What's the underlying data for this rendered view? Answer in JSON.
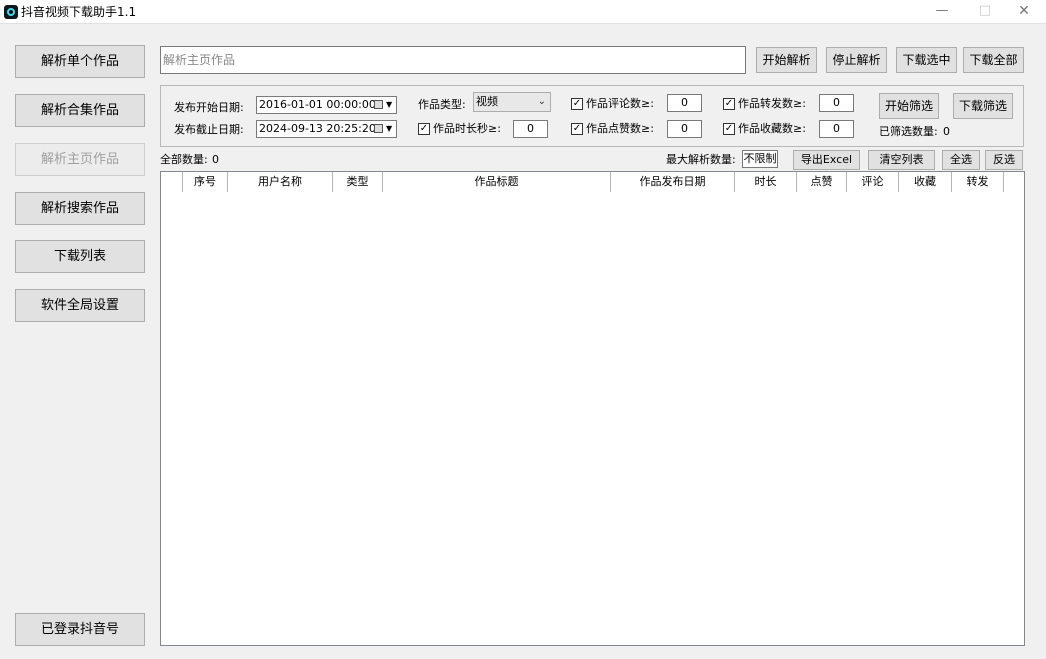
{
  "window": {
    "title": "抖音视频下载助手1.1",
    "minimize": "—",
    "maximize": "□",
    "close": "✕"
  },
  "sidebar": {
    "items": [
      {
        "label": "解析单个作品",
        "disabled": false
      },
      {
        "label": "解析合集作品",
        "disabled": false
      },
      {
        "label": "解析主页作品",
        "disabled": true
      },
      {
        "label": "解析搜索作品",
        "disabled": false
      },
      {
        "label": "下载列表",
        "disabled": false
      },
      {
        "label": "软件全局设置",
        "disabled": false
      }
    ],
    "logged_in": "已登录抖音号"
  },
  "toolbar": {
    "url_placeholder": "解析主页作品",
    "start_parse": "开始解析",
    "stop_parse": "停止解析",
    "download_selected": "下载选中",
    "download_all": "下载全部"
  },
  "filters": {
    "start_date_label": "发布开始日期:",
    "start_date_value": "2016-01-01 00:00:00",
    "end_date_label": "发布截止日期:",
    "end_date_value": "2024-09-13 20:25:20",
    "type_label": "作品类型:",
    "type_value": "视频",
    "duration": {
      "label": "作品时长秒≥:",
      "checked": true,
      "value": "0"
    },
    "comments": {
      "label": "作品评论数≥:",
      "checked": true,
      "value": "0"
    },
    "likes": {
      "label": "作品点赞数≥:",
      "checked": true,
      "value": "0"
    },
    "shares": {
      "label": "作品转发数≥:",
      "checked": true,
      "value": "0"
    },
    "favorites": {
      "label": "作品收藏数≥:",
      "checked": true,
      "value": "0"
    },
    "start_filter": "开始筛选",
    "download_filter": "下载筛选",
    "filtered_count_label": "已筛选数量:",
    "filtered_count": "0",
    "check_mark": "✓"
  },
  "list_bar": {
    "total_label": "全部数量:",
    "total": "0",
    "max_parse_label": "最大解析数量:",
    "max_parse_value": "不限制",
    "export_excel": "导出Excel",
    "clear_list": "清空列表",
    "select_all": "全选",
    "invert_select": "反选"
  },
  "table": {
    "columns": [
      "",
      "序号",
      "用户名称",
      "类型",
      "作品标题",
      "作品发布日期",
      "时长",
      "点赞",
      "评论",
      "收藏",
      "转发",
      ""
    ]
  }
}
